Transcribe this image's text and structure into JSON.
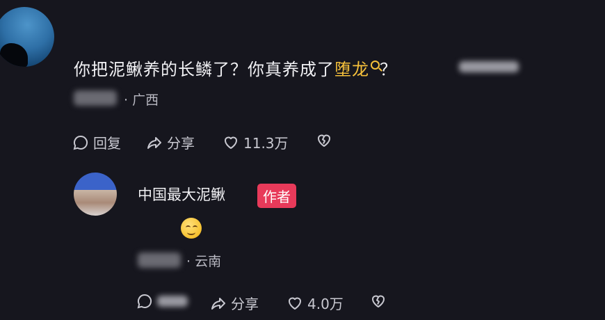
{
  "comment": {
    "text_before": "你把泥鳅养的长鳞了？你真养成了",
    "highlight": "堕龙",
    "text_after": "？",
    "location": "· 广西",
    "actions": {
      "reply": "回复",
      "share": "分享",
      "likes": "11.3万"
    }
  },
  "reply": {
    "author": "中国最大泥鳅",
    "badge": "作者",
    "location": "· 云南",
    "actions": {
      "share": "分享",
      "likes": "4.0万"
    }
  },
  "colors": {
    "background": "#16161e",
    "highlight": "#f5c03b",
    "badge": "#e83a5a"
  },
  "icons": [
    "search-icon",
    "reply-bubble-icon",
    "share-arrow-icon",
    "heart-icon",
    "broken-heart-icon",
    "smile-emoji"
  ]
}
